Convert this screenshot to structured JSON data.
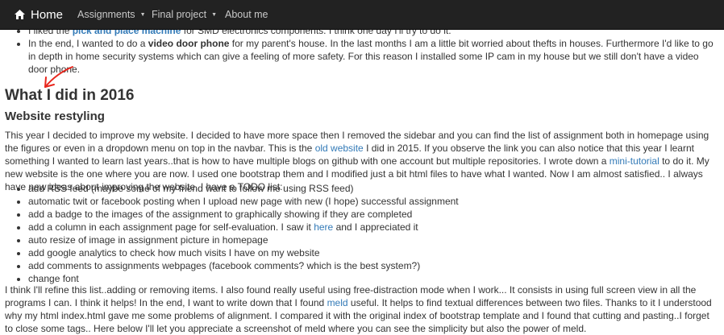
{
  "navbar": {
    "brand": "Home",
    "items": [
      {
        "label": "Assignments",
        "dropdown": true
      },
      {
        "label": "Final project",
        "dropdown": true
      },
      {
        "label": "About me",
        "dropdown": false
      }
    ]
  },
  "top_list": {
    "item1": {
      "pre": "I liked the ",
      "link": "pick and place machine",
      "post": " for SMD electronics components. I think one day I'll try to do it."
    },
    "item2": {
      "pre": "In the end, I wanted to do a ",
      "bold": "video door phone",
      "post": " for my parent's house. In the last months I am a little bit worried about thefts in houses. Furthermore I'd like to go in depth in home security systems which can give a feeling of more safety. For this reason I installed some IP cam in my house but we still don't have a video door phone."
    }
  },
  "heading_year": "What I did in 2016",
  "heading_section": "Website restyling",
  "para1": {
    "a": "This year I decided to improve my website. I decided to have more space then I removed the sidebar and you can find the list of assignment both in homepage using the figures or even in a dropdown menu on top in the navbar. This is the ",
    "link1": "old website",
    "b": " I did in 2015. If you observe the link you can also notice that this year I learnt something I wanted to learn last years..that is how to have multiple blogs on github with one account but multiple repositories. I wrote down a ",
    "link2": "mini-tutorial",
    "c": " to do it. My new website is the one where you are now. I used one bootstrap them and I modified just a bit html files to have what I wanted. Now I am almost satisfied.. I always have new ideas about improving the website. I have a TODO list:"
  },
  "todo": {
    "items": [
      "add RSS feed (maybe some of my friend want to follow me using RSS feed)",
      "automatic twit or facebook posting when I upload new page with new (I hope) successful assignment",
      "add a badge to the images of the assignment to graphically showing if they are completed"
    ],
    "item4_pre": "add a column in each assignment page for self-evaluation. I saw it ",
    "item4_link": "here",
    "item4_post": " and I appreciated it",
    "items_rest": [
      "auto resize of image in assignment picture in homepage",
      "add google analytics to check how much visits I have on my website",
      "add comments to assignments webpages (facebook comments? which is the best system?)",
      "change font"
    ]
  },
  "para2": {
    "a": "I think I'll refine this list..adding or removing items. I also found really useful using free-distraction mode when I work... It consists in using full screen view in all the programs I can. I think it helps! In the end, I want to write down that I found ",
    "link": "meld",
    "b": " useful. It helps to find textual differences between two files. Thanks to it I understood why my html index.html gave me some problems of alignment. I compared it with the original index of bootstrap template and I found that cutting and pasting..I forget to close some tags.. Here below I'll let you appreciate a screenshot of meld where you can see the simplicity but also the power of meld."
  },
  "colors": {
    "navbar_bg": "#222222",
    "link": "#337ab7",
    "text": "#333333",
    "annotation_arrow": "#e8261c"
  },
  "icons": [
    "home-icon",
    "caret-down-icon",
    "red-arrow-annotation"
  ]
}
